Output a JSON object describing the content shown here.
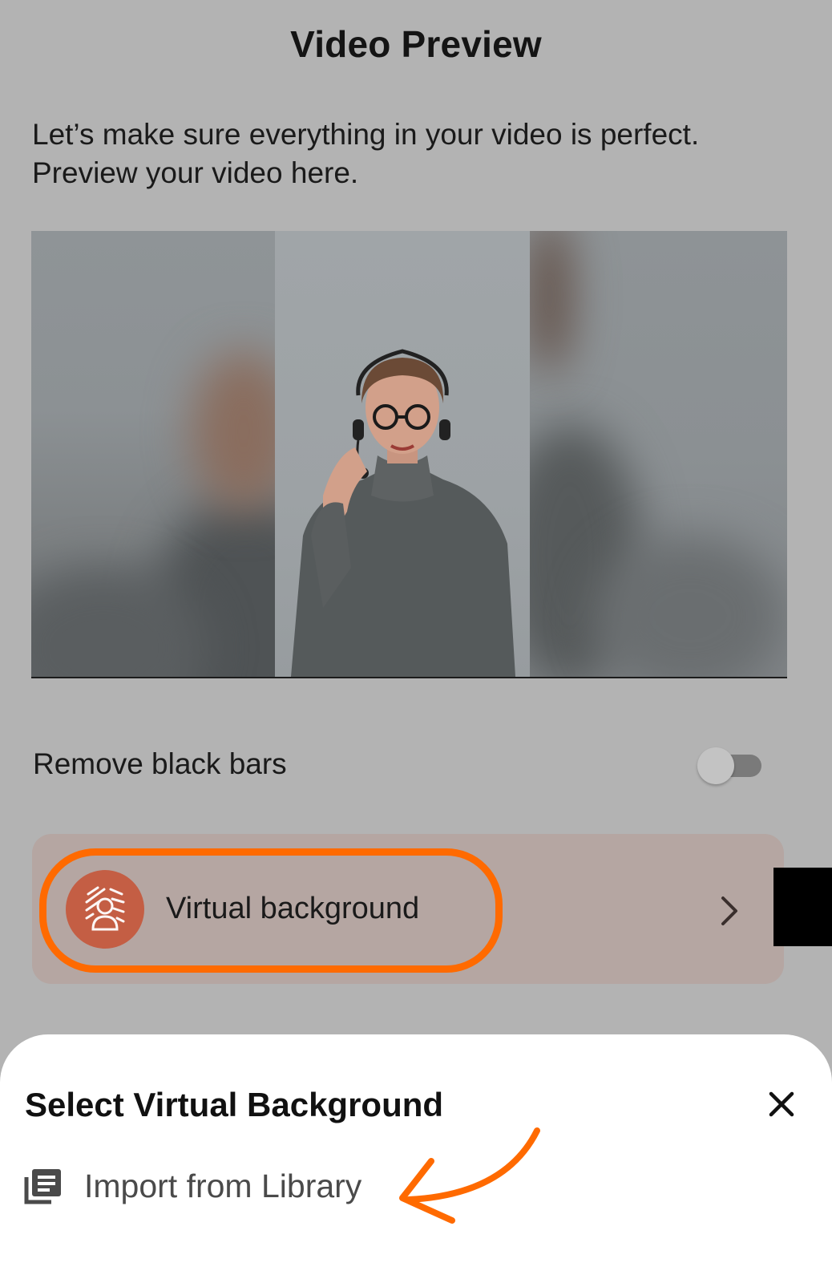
{
  "header": {
    "title": "Video Preview",
    "subtitle_line1": "Let’s make sure everything in your video is perfect.",
    "subtitle_line2": "Preview your video here."
  },
  "preview": {
    "image_description_icon": "person-with-headset"
  },
  "settings": {
    "remove_black_bars_label": "Remove black bars",
    "remove_black_bars_enabled": false
  },
  "virtual_background": {
    "label": "Virtual background",
    "icon": "virtual-background-icon",
    "accent_color": "#c45e44"
  },
  "sheet": {
    "title": "Select Virtual Background",
    "import_label": "Import from Library",
    "import_icon": "library-icon",
    "close_icon": "close-icon"
  },
  "annotations": {
    "highlight_color": "#ff6a00"
  }
}
